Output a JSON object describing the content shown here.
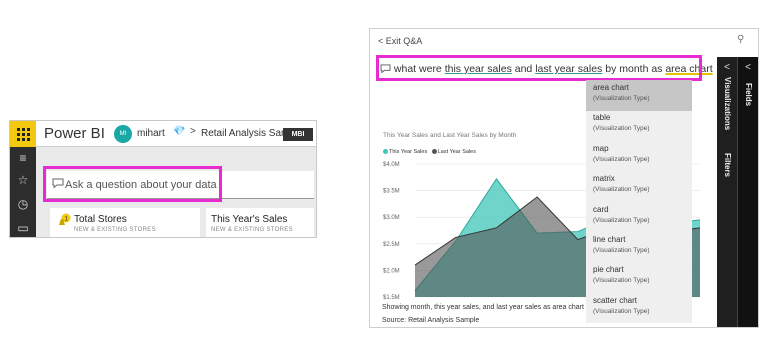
{
  "left_app": {
    "brand": "Power BI",
    "user_initials": "MI",
    "user_name": "mihart",
    "dataset_name": "Retail Analysis Sample",
    "badge": "MBI",
    "qna_placeholder": "Ask a question about your data",
    "tiles": [
      {
        "title": "Total Stores",
        "subtitle": "NEW & EXISTING STORES",
        "alert_count": "1"
      },
      {
        "title": "This Year's Sales",
        "subtitle": "NEW & EXISTING STORES"
      }
    ],
    "rail_icons": [
      "hamburger-icon",
      "star-icon",
      "clock-icon",
      "apps-icon"
    ]
  },
  "qa": {
    "exit_label": "Exit Q&A",
    "question_parts": [
      "what were ",
      "this year sales",
      " and ",
      "last year sales",
      " by month as ",
      "area chart"
    ],
    "chart_title": "This Year Sales and Last Year Sales by Month",
    "caption": "Showing month, this year sales, and last year sales as area chart",
    "source": "Source: Retail Analysis Sample",
    "panes": {
      "visualizations": "Visualizations",
      "filters": "Filters",
      "fields": "Fields"
    },
    "dropdown": [
      {
        "name": "area chart",
        "type": "(Visualization Type)"
      },
      {
        "name": "table",
        "type": "(Visualization Type)"
      },
      {
        "name": "map",
        "type": "(Visualization Type)"
      },
      {
        "name": "matrix",
        "type": "(Visualization Type)"
      },
      {
        "name": "card",
        "type": "(Visualization Type)"
      },
      {
        "name": "line chart",
        "type": "(Visualization Type)"
      },
      {
        "name": "pie chart",
        "type": "(Visualization Type)"
      },
      {
        "name": "scatter chart",
        "type": "(Visualization Type)"
      }
    ],
    "colors": {
      "highlight": "#e62bd0",
      "this_year": "#3fc6b8",
      "last_year": "#555555"
    }
  },
  "chart_data": {
    "type": "area",
    "title": "This Year Sales and Last Year Sales by Month",
    "ylim": [
      1.5,
      4.0
    ],
    "y_tick_labels": [
      "$4.0M",
      "$3.5M",
      "$3.0M",
      "$2.5M",
      "$2.0M",
      "$1.5M"
    ],
    "y_ticks": [
      4.0,
      3.5,
      3.0,
      2.5,
      2.0,
      1.5
    ],
    "x": [
      1,
      2,
      3,
      4,
      5,
      6,
      7,
      8
    ],
    "series": [
      {
        "name": "This Year Sales",
        "color": "#3fc6b8",
        "values": [
          1.62,
          2.55,
          3.72,
          2.7,
          2.73,
          3.05,
          2.85,
          2.95
        ]
      },
      {
        "name": "Last Year Sales",
        "color": "#555555",
        "values": [
          2.1,
          2.62,
          2.8,
          3.38,
          2.58,
          2.85,
          2.7,
          2.8
        ]
      }
    ]
  }
}
